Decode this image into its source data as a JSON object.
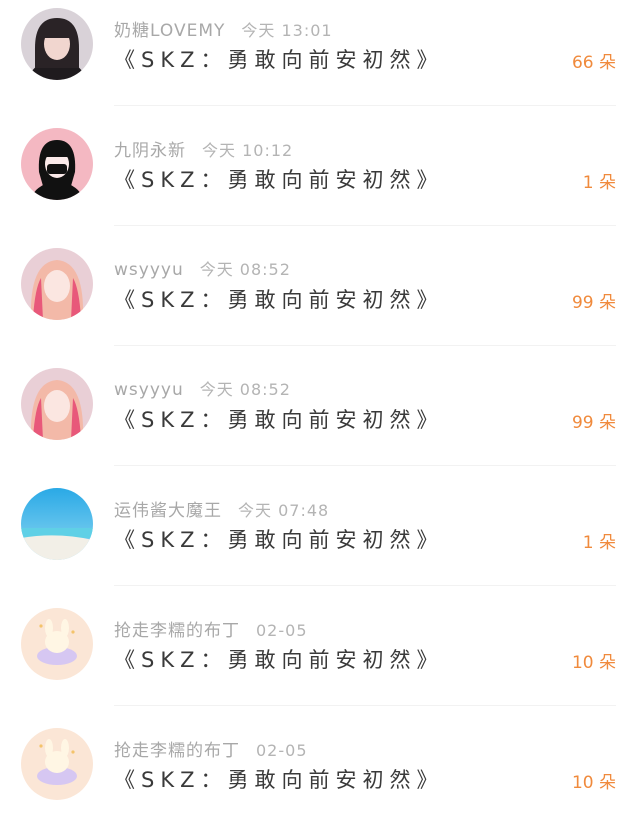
{
  "comments": [
    {
      "username": "奶糖LOVEMY",
      "time": "今天 13:01",
      "title": "《SKZ：勇敢向前安初然》",
      "count": "66 朵",
      "avatar_icon": "girl-portrait-avatar"
    },
    {
      "username": "九阴永新",
      "time": "今天 10:12",
      "title": "《SKZ：勇敢向前安初然》",
      "count": "1 朵",
      "avatar_icon": "masked-girl-illustration-avatar"
    },
    {
      "username": "wsyyyu",
      "time": "今天 08:52",
      "title": "《SKZ：勇敢向前安初然》",
      "count": "99 朵",
      "avatar_icon": "pink-hair-girl-avatar"
    },
    {
      "username": "wsyyyu",
      "time": "今天 08:52",
      "title": "《SKZ：勇敢向前安初然》",
      "count": "99 朵",
      "avatar_icon": "pink-hair-girl-avatar"
    },
    {
      "username": "运伟酱大魔王",
      "time": "今天 07:48",
      "title": "《SKZ：勇敢向前安初然》",
      "count": "1 朵",
      "avatar_icon": "beach-sea-avatar"
    },
    {
      "username": "抢走李糯的布丁",
      "time": "02-05",
      "title": "《SKZ：勇敢向前安初然》",
      "count": "10 朵",
      "avatar_icon": "cartoon-bunny-avatar"
    },
    {
      "username": "抢走李糯的布丁",
      "time": "02-05",
      "title": "《SKZ：勇敢向前安初然》",
      "count": "10 朵",
      "avatar_icon": "cartoon-bunny-avatar"
    }
  ],
  "colors": {
    "count": "#f08a3c",
    "meta": "#a8a8a8",
    "title": "#3a3a3a"
  }
}
